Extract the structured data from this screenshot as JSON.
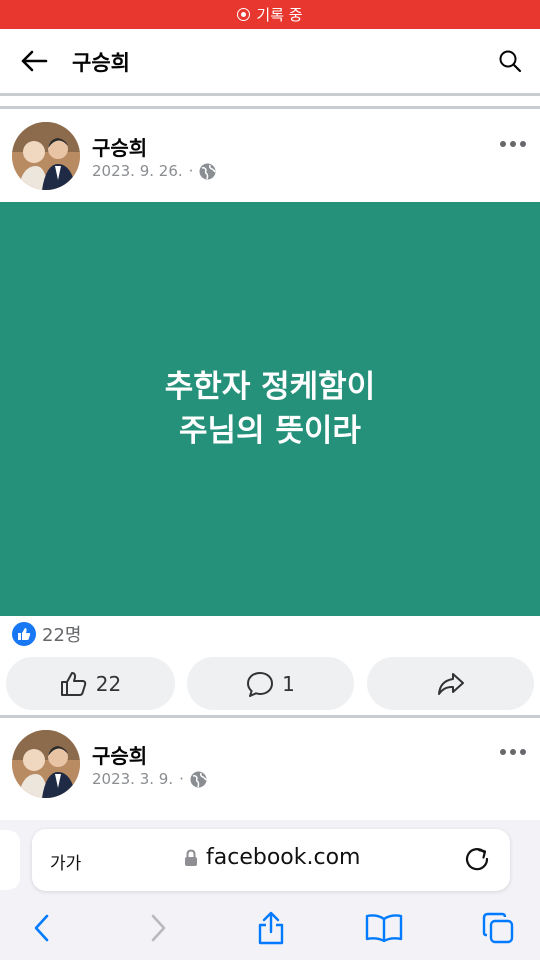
{
  "recording": {
    "label": "기록 중"
  },
  "header": {
    "title": "구승희"
  },
  "posts": [
    {
      "author": "구승희",
      "date": "2023. 9. 26.",
      "separator": "·",
      "text_lines": [
        "추한자 정케함이",
        "주님의 뜻이라"
      ],
      "reaction_count": "22명",
      "like_count": "22",
      "comment_count": "1"
    },
    {
      "author": "구승희",
      "date": "2023. 3. 9.",
      "separator": "·"
    }
  ],
  "browser": {
    "text_size": "가가",
    "url": "facebook.com"
  },
  "colors": {
    "accent": "#1877f2",
    "post_background": "#26917a",
    "recording_bar": "#e8372e",
    "safari_blue": "#007aff"
  }
}
